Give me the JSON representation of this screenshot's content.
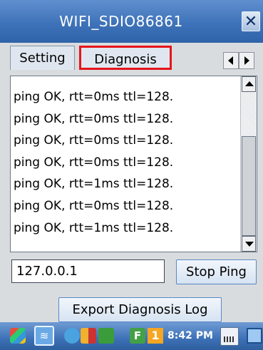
{
  "window": {
    "title": "WIFI_SDIO86861",
    "close_glyph": "✕"
  },
  "tabs": [
    {
      "label": "Setting",
      "selected": false
    },
    {
      "label": "Diagnosis",
      "selected": true
    }
  ],
  "log": {
    "lines": [
      "ping OK, rtt=0ms ttl=128.",
      "ping OK, rtt=0ms ttl=128.",
      "ping OK, rtt=0ms ttl=128.",
      "ping OK, rtt=0ms ttl=128.",
      "ping OK, rtt=1ms ttl=128.",
      "ping OK, rtt=0ms ttl=128.",
      "ping OK, rtt=1ms ttl=128."
    ]
  },
  "ping": {
    "address_value": "127.0.0.1",
    "stop_label": "Stop Ping"
  },
  "export": {
    "label": "Export Diagnosis Log"
  },
  "taskbar": {
    "time": "8:42 PM",
    "f_badge": "F",
    "one_badge": "1",
    "wifi_glyph": "≋"
  },
  "colors": {
    "titlebar": "#3f73b9",
    "highlight": "#e5141b",
    "content_bg": "#d9dcdf"
  },
  "icons": [
    "start-icon",
    "wifi-icon",
    "network-icon",
    "bluetooth-icon",
    "power-icon",
    "f-icon",
    "keyboard-icon",
    "desktop-icon"
  ]
}
